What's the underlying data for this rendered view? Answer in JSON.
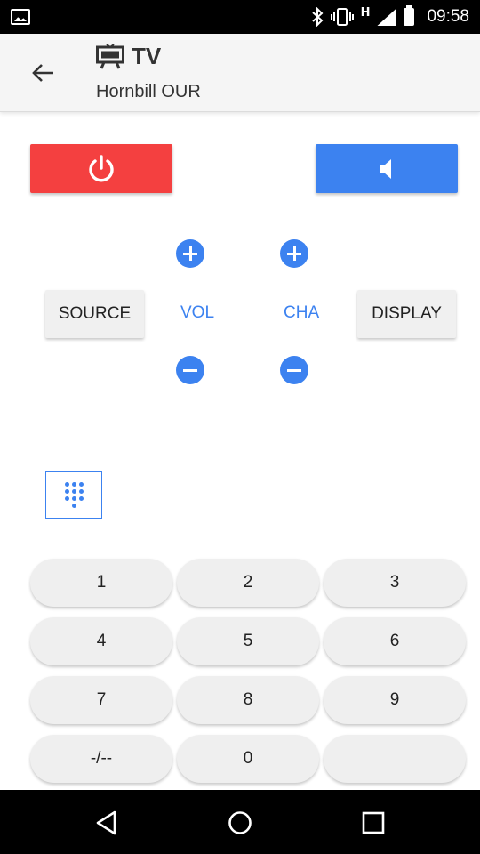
{
  "status_bar": {
    "network_label": "H",
    "time": "09:58"
  },
  "app_bar": {
    "title": "TV",
    "subtitle": "Hornbill OUR",
    "icons": {
      "back": "arrow-back-icon",
      "title": "tv-icon"
    }
  },
  "controls": {
    "power_icon": "power-icon",
    "mute_icon": "volume-mute-icon",
    "source_label": "SOURCE",
    "display_label": "DISPLAY",
    "vol_label": "VOL",
    "cha_label": "CHA"
  },
  "keypad_toggle_icon": "dialpad-icon",
  "keypad": {
    "keys": [
      "1",
      "2",
      "3",
      "4",
      "5",
      "6",
      "7",
      "8",
      "9",
      "-/--",
      "0",
      ""
    ]
  },
  "colors": {
    "power": "#f44040",
    "accent": "#3c82f0",
    "button_bg": "#efefef"
  }
}
